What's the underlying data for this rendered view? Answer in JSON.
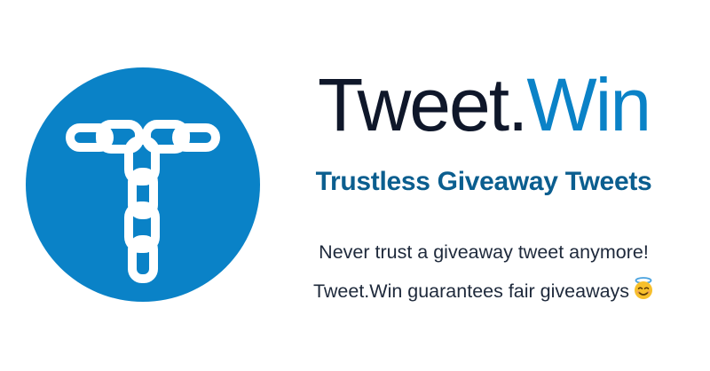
{
  "brand": {
    "part1": "Tweet.",
    "part2": "Win"
  },
  "tagline": "Trustless Giveaway Tweets",
  "description": {
    "line1": "Never trust a giveaway tweet anymore!",
    "line2": "Tweet.Win guarantees fair giveaways"
  },
  "icons": {
    "logo": "chain-letter-t-logo",
    "emoji": "smiling-face-with-halo-icon"
  },
  "colors": {
    "brand_blue": "#0a82c7",
    "dark_text": "#0f172a",
    "tagline": "#0b5e8f"
  }
}
